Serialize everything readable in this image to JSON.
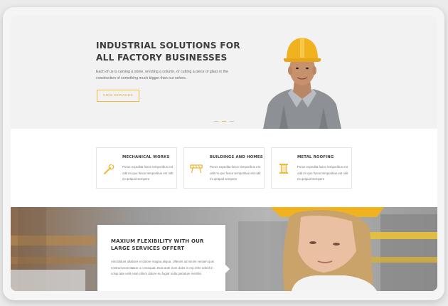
{
  "hero": {
    "title": "INDUSTRIAL SOLUTIONS FOR ALL FACTORY BUSINESSES",
    "description": "Each of us is carving a stone, erecting a column, or cutting a piece of glass in the construction of something much bigger than our selves.",
    "button_label": "VIEW SERVICES",
    "slider_active_index": 1
  },
  "services": [
    {
      "title": "MECHANICAL WORKS",
      "text": "Purus expedita fusce temporibus est odit mi quo fusce temporibus est odit mi qelquid sempere",
      "icon": "wrench-icon"
    },
    {
      "title": "BUILDINGS AND HOMES",
      "text": "Purus expedita fusce temporibus est odit mi quo fusce temporibus est odit mi qelquid sempere",
      "icon": "barrier-icon"
    },
    {
      "title": "METAL ROOFING",
      "text": "Purus expedita fusce temporibus est odit mi quo fusce temporibus est odit mi qelquid sempere",
      "icon": "spool-icon"
    }
  ],
  "feature": {
    "title": "MAXIUM FLEXIBILITY WITH OUR LARGE SERVICES OFFERT",
    "text": "Aincididunt ullabore et dolore magna aliqua. Ullenim ad minim veniam quis nostrud exercitation u o nsequat. Duis aute irure dolor in rep rehe nderit in volup tate velit esse cillum dolore eu fugiat nulla pariature mertilis."
  },
  "colors": {
    "accent": "#f0b93a",
    "title": "#3e3e3e",
    "body_text": "#777777",
    "hero_bg": "#f2f2f2"
  }
}
